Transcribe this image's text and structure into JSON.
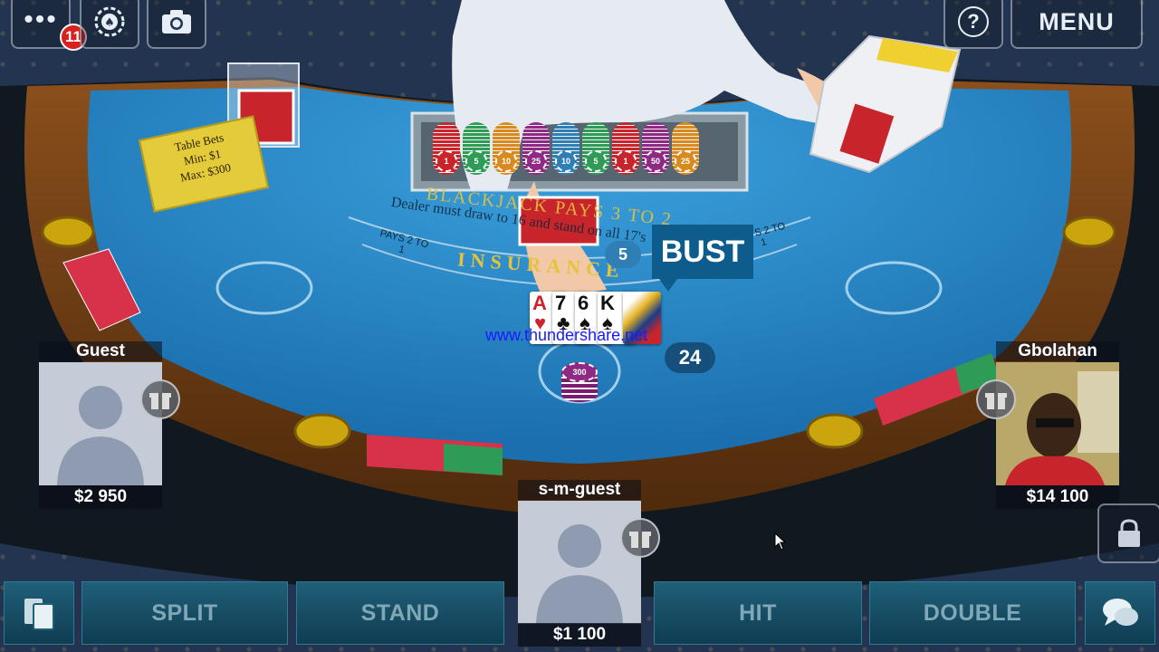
{
  "top_bar": {
    "notifications_count": "11",
    "help_label": "?",
    "menu_label": "MENU"
  },
  "table": {
    "bets_sign": {
      "title": "Table Bets",
      "min": "Min: $1",
      "max": "Max: $300"
    },
    "felt": {
      "blackjack_text": "BLACKJACK PAYS 3 TO 2",
      "dealer_rule": "Dealer must draw to 16 and stand on all 17's",
      "insurance_text": "INSURANCE",
      "pays_left": "PAYS 2 TO 1",
      "pays_right": "PAYS 2 TO 1"
    },
    "dealer_score": "5",
    "bust_label": "BUST",
    "player_hand_score": "24",
    "bet_chip_value": "300",
    "watermark": "www.thundershare.net",
    "hand_cards": [
      {
        "rank": "A",
        "suit": "♥",
        "color": "#d2202a"
      },
      {
        "rank": "7",
        "suit": "♣",
        "color": "#111111"
      },
      {
        "rank": "6",
        "suit": "♠",
        "color": "#111111"
      },
      {
        "rank": "K",
        "suit": "♠",
        "color": "#111111"
      }
    ],
    "chip_rack_values": [
      "1",
      "5",
      "10",
      "25",
      "10",
      "5",
      "1",
      "50",
      "25"
    ]
  },
  "players": [
    {
      "name": "Guest",
      "balance": "$2 950"
    },
    {
      "name": "s-m-guest",
      "balance": "$1 100"
    },
    {
      "name": "Gbolahan",
      "balance": "$14 100"
    }
  ],
  "actions": {
    "split": "SPLIT",
    "stand": "STAND",
    "hit": "HIT",
    "double": "DOUBLE"
  },
  "colors": {
    "felt": "#1f7fc0",
    "felt_light": "#3aa0dc",
    "rail": "#6b3a12",
    "bust_bg": "#0d5c8c",
    "button_text": "#7fa7b6"
  }
}
